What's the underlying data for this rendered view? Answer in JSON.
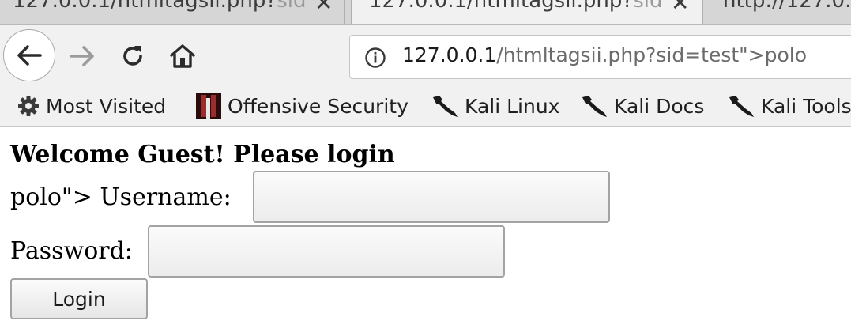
{
  "tabs": [
    {
      "label_main": "127.0.0.1/htmltagsii.php?",
      "label_dim": "sid",
      "close": "✕"
    },
    {
      "label_main": "127.0.0.1/htmltagsii.php?",
      "label_dim": "sid",
      "close": "✕"
    },
    {
      "label_main": "http://127.0.0."
    }
  ],
  "toolbar": {
    "icons": [
      "back-icon",
      "forward-icon",
      "reload-icon",
      "home-icon",
      "info-icon"
    ],
    "url_host": "127.0.0.1",
    "url_path": "/htmltagsii.php?sid=test\">polo"
  },
  "bookmarks": {
    "most_visited": "Most Visited",
    "offsec": "Offensive Security",
    "kali_linux": "Kali Linux",
    "kali_docs": "Kali Docs",
    "kali_tools": "Kali Tools"
  },
  "page": {
    "welcome": "Welcome Guest! Please login",
    "username_label": "polo\"> Username:",
    "password_label": "Password:",
    "username_value": "",
    "password_value": "",
    "login_button": "Login"
  },
  "colors": {
    "tabstrip": "#d6d6d6",
    "toolbar": "#f1f1f1",
    "url_path": "#6b6b6b"
  }
}
